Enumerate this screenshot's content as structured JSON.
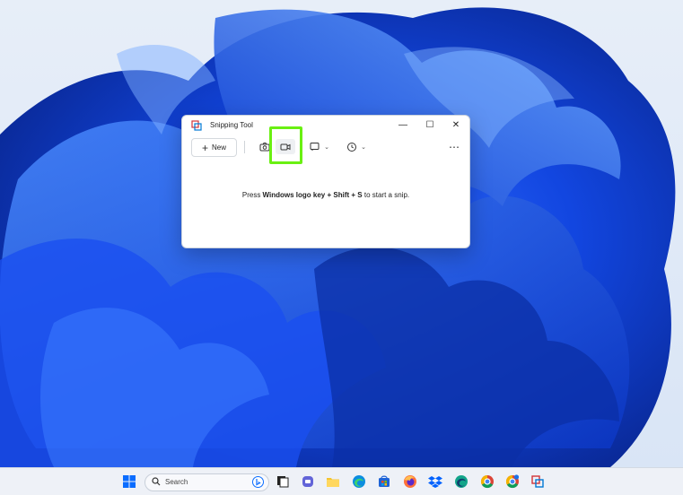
{
  "window": {
    "title": "Snipping Tool",
    "minimize": "—",
    "maximize": "☐",
    "close": "✕"
  },
  "toolbar": {
    "new_label": "New",
    "new_plus": "+",
    "more": "⋯",
    "chevron": "⌄"
  },
  "hint": {
    "prefix": "Press ",
    "key1": "Windows logo key",
    "plus1": " + ",
    "key2": "Shift",
    "plus2": " + ",
    "key3": "S",
    "suffix": " to start a snip."
  },
  "taskbar": {
    "search_placeholder": "Search",
    "icons": [
      "start-icon",
      "task-view-icon",
      "teams-icon",
      "file-explorer-icon",
      "edge-icon",
      "store-icon",
      "firefox-icon",
      "dropbox-icon",
      "edge-dev-icon",
      "chrome-icon",
      "chrome-beta-icon",
      "snipping-tool-icon"
    ]
  },
  "colors": {
    "highlight": "#6af012",
    "accent": "#0a5bd6",
    "wallpaper": "#1f5bff"
  }
}
